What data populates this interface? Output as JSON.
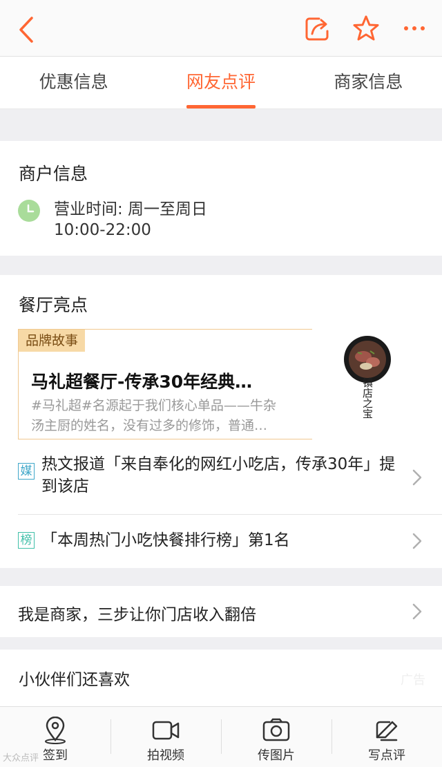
{
  "header": {
    "back_icon": "chevron-left-icon",
    "actions": [
      "share-icon",
      "star-icon",
      "more-icon"
    ],
    "accent": "#ff6633"
  },
  "tabs": [
    {
      "label": "优惠信息",
      "active": false
    },
    {
      "label": "网友点评",
      "active": true
    },
    {
      "label": "商家信息",
      "active": false
    }
  ],
  "merchant_info": {
    "title": "商户信息",
    "hours_line1": "营业时间: 周一至周日",
    "hours_line2": "10:00-22:00"
  },
  "highlights": {
    "title": "餐厅亮点",
    "story": {
      "badge": "品牌故事",
      "title": "马礼超餐厅-传承30年经典…",
      "desc_line1": "#马礼超#名源起于我们核心单品——牛杂",
      "desc_line2": "汤主厨的姓名，没有过多的修饰，普通…",
      "image_caption": "镇店之宝"
    },
    "media": {
      "tag": "媒",
      "text": "热文报道「来自奉化的网红小吃店，传承30年」提到该店"
    },
    "ranking": {
      "tag": "榜",
      "text": "「本周热门小吃快餐排行榜」第1名"
    }
  },
  "merchant_prompt": {
    "text": "我是商家，三步让你门店收入翻倍"
  },
  "also_like": {
    "title": "小伙伴们还喜欢",
    "ad": "广告"
  },
  "bottom_bar": [
    {
      "label": "签到",
      "icon": "location-pin-icon"
    },
    {
      "label": "拍视频",
      "icon": "video-camera-icon"
    },
    {
      "label": "传图片",
      "icon": "photo-camera-icon"
    },
    {
      "label": "写点评",
      "icon": "edit-icon"
    }
  ],
  "watermark": "大众点评"
}
